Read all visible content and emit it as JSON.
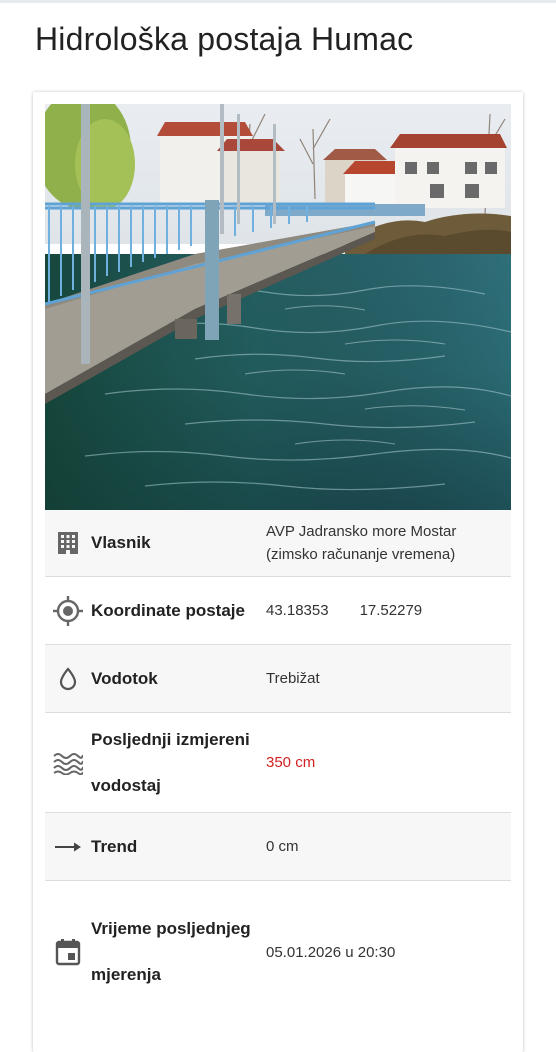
{
  "page": {
    "title": "Hidrološka postaja Humac"
  },
  "photo": {
    "alt": "Most preko rijeke Trebižat"
  },
  "rows": [
    {
      "icon": "building-icon",
      "label": "Vlasnik",
      "value": "AVP Jadransko more Mostar (zimsko računanje vremena)"
    },
    {
      "icon": "location-target-icon",
      "label": "Koordinate postaje",
      "lat": "43.18353",
      "lon": "17.52279"
    },
    {
      "icon": "water-drop-icon",
      "label": "Vodotok",
      "value": "Trebižat"
    },
    {
      "icon": "waves-icon",
      "label": "Posljednji izmjereni vodostaj",
      "value": "350 cm",
      "value_color": "#d32222"
    },
    {
      "icon": "arrow-right-icon",
      "label": "Trend",
      "value": "0 cm"
    },
    {
      "icon": "calendar-icon",
      "label": "Vrijeme posljednjeg mjerenja",
      "value": "05.01.2026 u 20:30"
    }
  ]
}
